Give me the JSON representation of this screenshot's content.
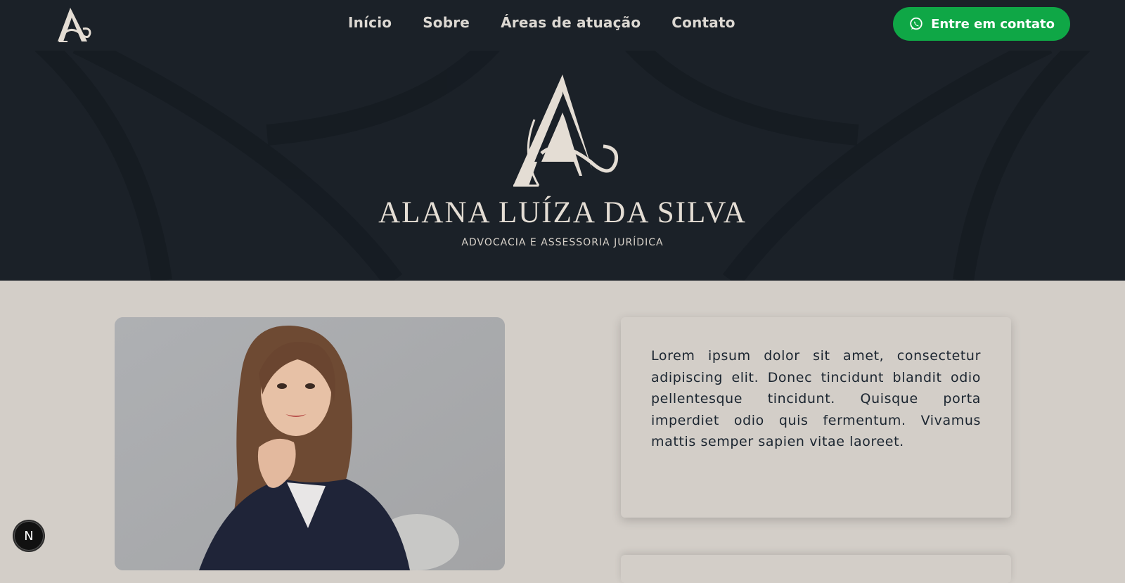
{
  "nav": {
    "items": [
      {
        "label": "Início"
      },
      {
        "label": "Sobre"
      },
      {
        "label": "Áreas de atuação"
      },
      {
        "label": "Contato"
      }
    ],
    "cta_label": "Entre em contato",
    "cta_icon": "whatsapp-icon"
  },
  "hero": {
    "logo_letters": "A",
    "name": "ALANA LUÍZA DA SILVA",
    "subtitle": "ADVOCACIA E ASSESSORIA JURÍDICA"
  },
  "about": {
    "paragraph": "Lorem ipsum dolor sit amet, consectetur adipiscing elit. Donec tincidunt blandit odio pellentesque tincidunt. Quisque porta imperdiet odio quis fermentum. Vivamus mattis semper sapien vitae laoreet."
  },
  "badge": {
    "label": "N"
  },
  "colors": {
    "nav_bg": "#1b2128",
    "page_bg": "#d3cec8",
    "accent_green": "#0fa746",
    "logo_cream": "#e4ddd4",
    "text_dark": "#1b2530"
  }
}
